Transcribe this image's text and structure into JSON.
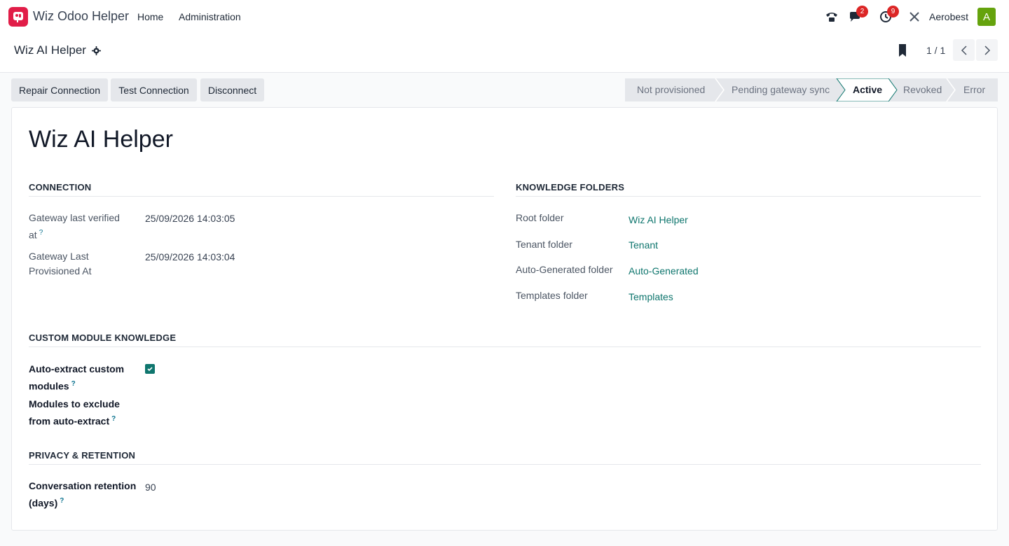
{
  "navbar": {
    "app_name": "Wiz Odoo Helper",
    "menu": [
      "Home",
      "Administration"
    ],
    "messages_count": "2",
    "activities_count": "9",
    "company": "Aerobest",
    "avatar_initial": "A"
  },
  "control_panel": {
    "breadcrumb": "Wiz AI Helper",
    "pager": "1 / 1"
  },
  "actions": {
    "repair": "Repair Connection",
    "test": "Test Connection",
    "disconnect": "Disconnect"
  },
  "status": {
    "stages": [
      "Not provisioned",
      "Pending gateway sync",
      "Active",
      "Revoked",
      "Error"
    ],
    "current": "Active"
  },
  "record": {
    "title": "Wiz AI Helper",
    "connection": {
      "heading": "CONNECTION",
      "verified_label_1": "Gateway last verified",
      "verified_label_2": "at",
      "verified_value": "25/09/2026 14:03:05",
      "provisioned_label_1": "Gateway Last",
      "provisioned_label_2": "Provisioned At",
      "provisioned_value": "25/09/2026 14:03:04"
    },
    "knowledge": {
      "heading": "KNOWLEDGE FOLDERS",
      "root_label": "Root folder",
      "root_value": "Wiz AI Helper",
      "tenant_label": "Tenant folder",
      "tenant_value": "Tenant",
      "auto_label": "Auto-Generated folder",
      "auto_value": "Auto-Generated",
      "templates_label": "Templates folder",
      "templates_value": "Templates"
    },
    "custom": {
      "heading": "CUSTOM MODULE KNOWLEDGE",
      "extract_label_1": "Auto-extract custom",
      "extract_label_2": "modules",
      "extract_checked": true,
      "exclude_label_1": "Modules to exclude",
      "exclude_label_2": "from auto-extract"
    },
    "privacy": {
      "heading": "PRIVACY & RETENTION",
      "retention_label_1": "Conversation retention",
      "retention_label_2": "(days)",
      "retention_value": "90"
    }
  },
  "colors": {
    "brand": "#e11d48",
    "accent": "#0f766e",
    "badge": "#dc2626",
    "avatar": "#65a30d"
  },
  "icons": [
    "phone-icon",
    "chat-icon",
    "clock-icon",
    "tools-icon",
    "gear-icon",
    "bookmark-icon",
    "chevron-left-icon",
    "chevron-right-icon",
    "check-icon"
  ]
}
